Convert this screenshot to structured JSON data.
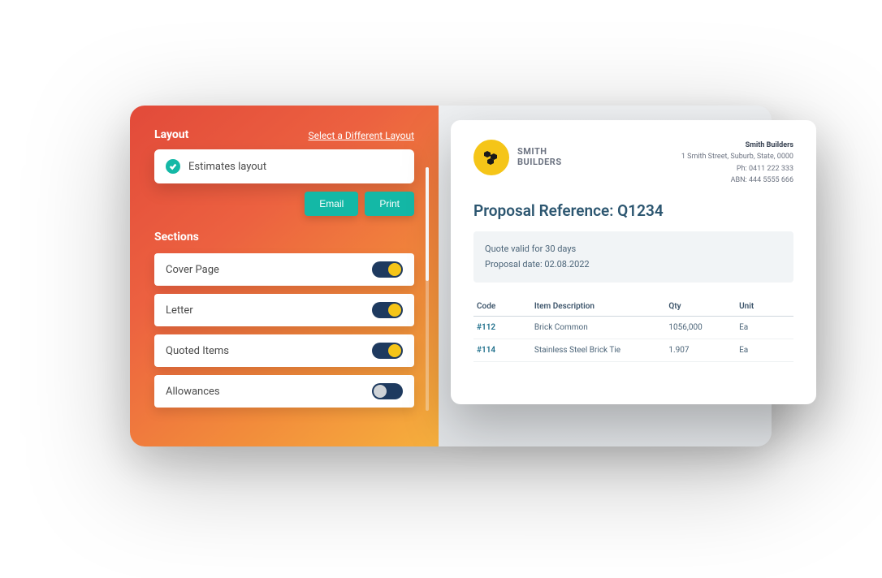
{
  "layout": {
    "heading": "Layout",
    "select_different": "Select a Different Layout",
    "selected": "Estimates layout"
  },
  "buttons": {
    "email": "Email",
    "print": "Print"
  },
  "sections": {
    "heading": "Sections",
    "items": [
      {
        "label": "Cover Page",
        "on": true
      },
      {
        "label": "Letter",
        "on": true
      },
      {
        "label": "Quoted Items",
        "on": true
      },
      {
        "label": "Allowances",
        "on": false
      }
    ]
  },
  "preview": {
    "brand_line1": "SMITH",
    "brand_line2": "BUILDERS",
    "company": "Smith Builders",
    "address": "1 Smith Street, Suburb, State, 0000",
    "phone": "Ph: 0411 222 333",
    "abn": "ABN: 444 5555 666",
    "title": "Proposal Reference: Q1234",
    "valid": "Quote valid for 30 days",
    "date": "Proposal date: 02.08.2022",
    "cols": {
      "code": "Code",
      "desc": "Item Description",
      "qty": "Qty",
      "unit": "Unit"
    },
    "rows": [
      {
        "code": "#112",
        "desc": "Brick Common",
        "qty": "1056,000",
        "unit": "Ea"
      },
      {
        "code": "#114",
        "desc": "Stainless Steel Brick Tie",
        "qty": "1.907",
        "unit": "Ea"
      }
    ]
  }
}
